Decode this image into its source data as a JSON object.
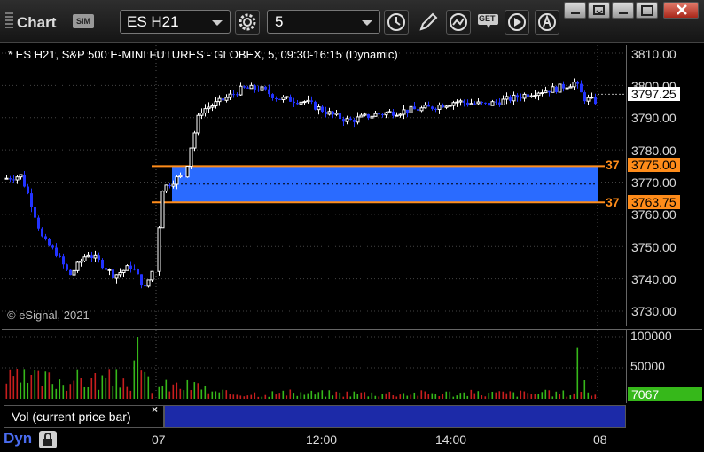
{
  "toolbar": {
    "title": "Chart",
    "sim_badge": "SIM",
    "symbol_value": "ES H21",
    "interval_value": "5",
    "get_label": "GET"
  },
  "chart": {
    "header": "* ES H21, S&P 500 E-MINI FUTURES - GLOBEX, 5, 09:30-16:15 (Dynamic)",
    "copyright": "© eSignal, 2021",
    "price_ticks": [
      "3810.00",
      "3800.00",
      "3790.00",
      "3780.00",
      "3770.00",
      "3760.00",
      "3750.00",
      "3740.00",
      "3730.00"
    ],
    "last_price": "3797.25",
    "zone_upper_price": "3775.00",
    "zone_lower_price": "3763.75",
    "zone_upper_tag": "37",
    "zone_lower_tag": "37",
    "colors": {
      "up_candle": "#ffffff",
      "down_candle": "#2233ff",
      "zone_fill": "#2a6bff",
      "zone_line": "#ff8c1a",
      "volume_up": "#36b81a",
      "volume_down": "#c81e1e"
    }
  },
  "volume": {
    "ticks": [
      "100000",
      "50000"
    ],
    "last_volume": "7067",
    "study_label": "Vol (current price bar)",
    "close_glyph": "×"
  },
  "time_axis": {
    "mode_label": "Dyn",
    "labels": [
      "07",
      "12:00",
      "14:00",
      "08"
    ]
  },
  "icons": [
    "grip-icon",
    "chevron-down-icon",
    "settings-gear-icon",
    "clock-icon",
    "pencil-icon",
    "study-wave-icon",
    "get-data-icon",
    "play-icon",
    "alert-icon",
    "minimize-icon",
    "restore-icon",
    "maximize-icon",
    "close-icon",
    "lock-icon"
  ]
}
